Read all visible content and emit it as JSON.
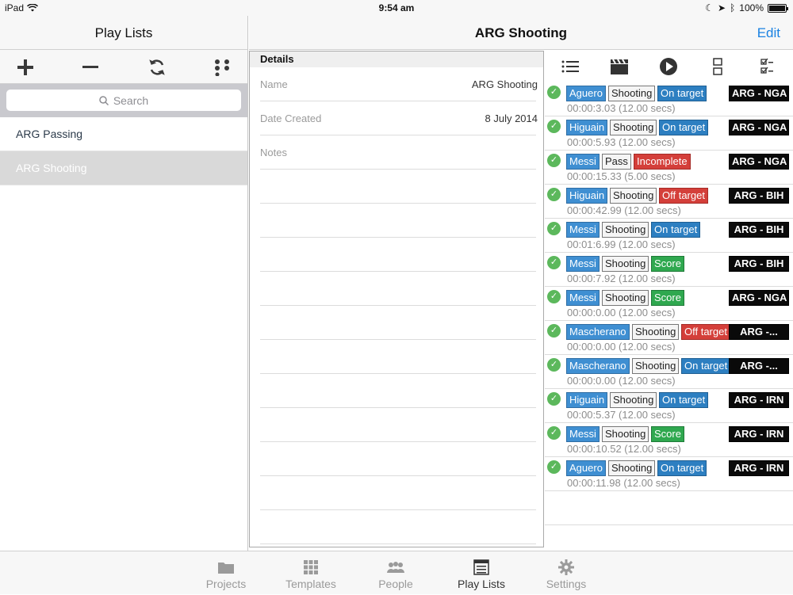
{
  "status_bar": {
    "device": "iPad",
    "time": "9:54 am",
    "battery": "100%"
  },
  "left": {
    "title": "Play Lists",
    "search_placeholder": "Search",
    "playlists": [
      {
        "label": "ARG Passing",
        "selected": false
      },
      {
        "label": "ARG Shooting",
        "selected": true
      }
    ]
  },
  "header": {
    "title": "ARG Shooting",
    "edit_label": "Edit"
  },
  "details": {
    "heading": "Details",
    "name_label": "Name",
    "name_value": "ARG Shooting",
    "date_label": "Date Created",
    "date_value": "8 July 2014",
    "notes_label": "Notes"
  },
  "clips": [
    {
      "player": "Aguero",
      "action": "Shooting",
      "outcome": "On target",
      "outcome_color": "blue",
      "match": "ARG - NGA",
      "time": "00:00:3.03 (12.00 secs)"
    },
    {
      "player": "Higuain",
      "action": "Shooting",
      "outcome": "On target",
      "outcome_color": "blue",
      "match": "ARG - NGA",
      "time": "00:00:5.93 (12.00 secs)"
    },
    {
      "player": "Messi",
      "action": "Pass",
      "outcome": "Incomplete",
      "outcome_color": "red",
      "match": "ARG - NGA",
      "time": "00:00:15.33 (5.00 secs)"
    },
    {
      "player": "Higuain",
      "action": "Shooting",
      "outcome": "Off target",
      "outcome_color": "red",
      "match": "ARG - BIH",
      "time": "00:00:42.99 (12.00 secs)"
    },
    {
      "player": "Messi",
      "action": "Shooting",
      "outcome": "On target",
      "outcome_color": "blue",
      "match": "ARG - BIH",
      "time": "00:01:6.99 (12.00 secs)"
    },
    {
      "player": "Messi",
      "action": "Shooting",
      "outcome": "Score",
      "outcome_color": "green",
      "match": "ARG - BIH",
      "time": "00:00:7.92 (12.00 secs)"
    },
    {
      "player": "Messi",
      "action": "Shooting",
      "outcome": "Score",
      "outcome_color": "green",
      "match": "ARG - NGA",
      "time": "00:00:0.00 (12.00 secs)"
    },
    {
      "player": "Mascherano",
      "action": "Shooting",
      "outcome": "Off target",
      "outcome_color": "red",
      "match": "ARG -...",
      "time": "00:00:0.00 (12.00 secs)"
    },
    {
      "player": "Mascherano",
      "action": "Shooting",
      "outcome": "On target",
      "outcome_color": "blue",
      "match": "ARG -...",
      "time": "00:00:0.00 (12.00 secs)"
    },
    {
      "player": "Higuain",
      "action": "Shooting",
      "outcome": "On target",
      "outcome_color": "blue",
      "match": "ARG - IRN",
      "time": "00:00:5.37 (12.00 secs)"
    },
    {
      "player": "Messi",
      "action": "Shooting",
      "outcome": "Score",
      "outcome_color": "green",
      "match": "ARG - IRN",
      "time": "00:00:10.52 (12.00 secs)"
    },
    {
      "player": "Aguero",
      "action": "Shooting",
      "outcome": "On target",
      "outcome_color": "blue",
      "match": "ARG - IRN",
      "time": "00:00:11.98 (12.00 secs)"
    }
  ],
  "tabs": [
    {
      "label": "Projects",
      "icon": "folder-icon",
      "active": false
    },
    {
      "label": "Templates",
      "icon": "grid-icon",
      "active": false
    },
    {
      "label": "People",
      "icon": "people-icon",
      "active": false
    },
    {
      "label": "Play Lists",
      "icon": "list-icon",
      "active": true
    },
    {
      "label": "Settings",
      "icon": "gear-icon",
      "active": false
    }
  ],
  "colors": {
    "accent": "#1a82e2",
    "player_tag": "#3f8fd2",
    "on_target": "#2d7fc1",
    "off_target": "#d43f3a",
    "score": "#2fa84f",
    "match_tag": "#0a0a0a",
    "check": "#5cb85c"
  }
}
